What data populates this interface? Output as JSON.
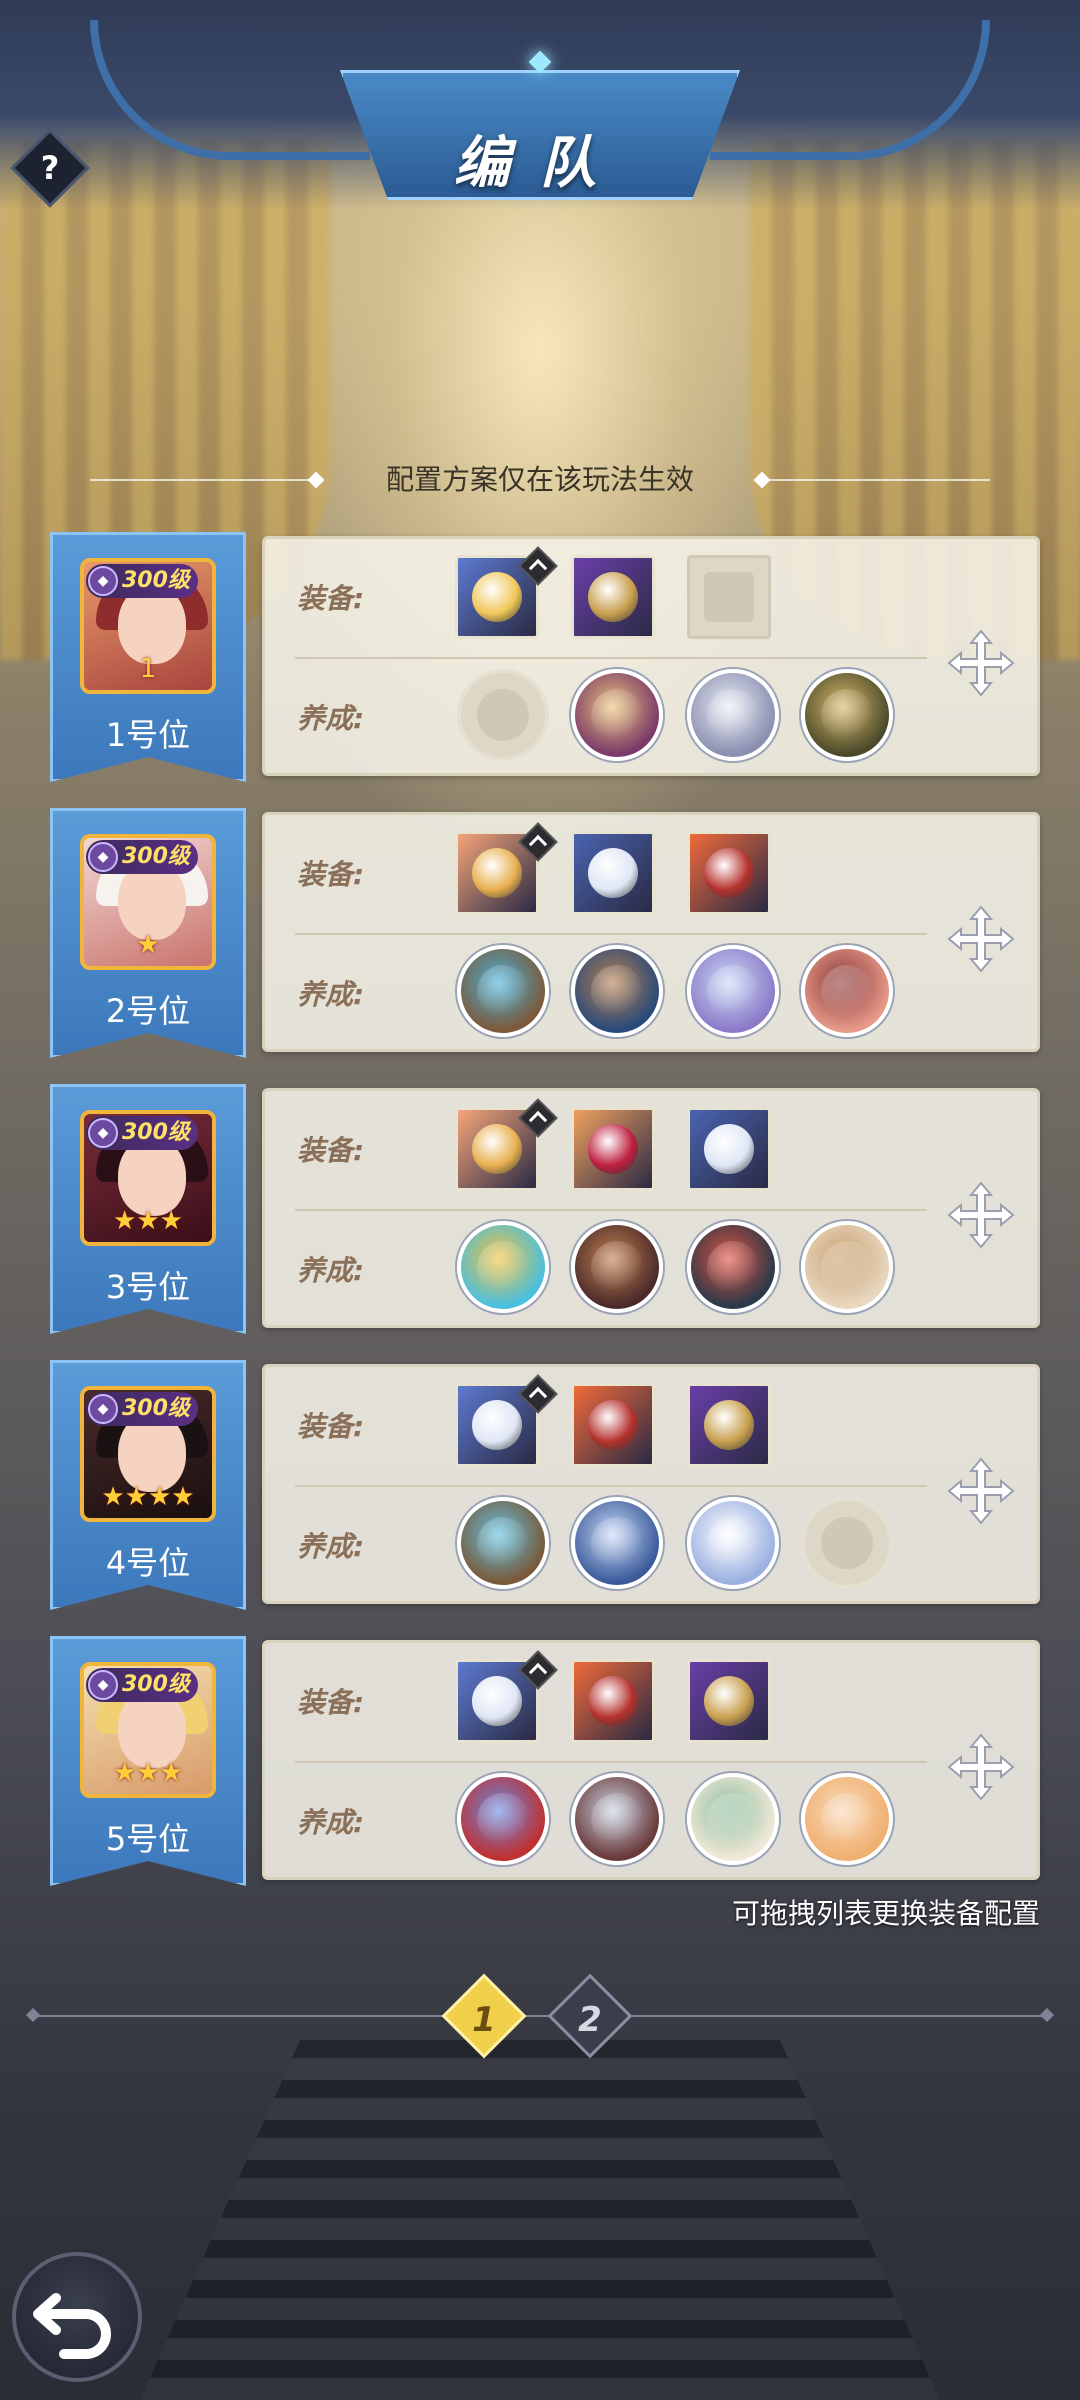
{
  "header": {
    "title": "编队",
    "help_label": "?"
  },
  "subtitle": "配置方案仅在该玩法生效",
  "labels": {
    "equip": "装备:",
    "train": "养成:"
  },
  "slots": [
    {
      "level": "300级",
      "stars": "1",
      "label": "1号位",
      "portrait_colors": [
        "#e79a6a",
        "#a8443e"
      ],
      "hair_color": "#8f2c2c",
      "equip": [
        {
          "name": "ring-icon",
          "bg": "#5d7ad0",
          "color": "#f0c75a",
          "locked": true
        },
        {
          "name": "amulet-icon",
          "bg": "#6a3fa8",
          "color": "#c9a050",
          "locked": false
        },
        {
          "name": "empty-slot-icon",
          "empty": true
        }
      ],
      "train": [
        {
          "name": "empty-slot-icon",
          "empty": true
        },
        {
          "name": "orb-icon",
          "bg": "#7a3a6a",
          "color": "#e8c07a"
        },
        {
          "name": "owl-pet-icon",
          "bg": "#8a8fb0",
          "color": "#e9ecf5"
        },
        {
          "name": "mask-icon",
          "bg": "#4a4a2a",
          "color": "#d8b86a"
        }
      ]
    },
    {
      "level": "300级",
      "stars": "★",
      "label": "2号位",
      "portrait_colors": [
        "#f3d8d5",
        "#c9736c"
      ],
      "hair_color": "#f6f2ee",
      "equip": [
        {
          "name": "ring-icon",
          "bg": "#f5a57a",
          "color": "#e8b050",
          "locked": true
        },
        {
          "name": "cross-icon",
          "bg": "#4a64b0",
          "color": "#dfe6f5",
          "locked": false
        },
        {
          "name": "shield-icon",
          "bg": "#ef6a3a",
          "color": "#b5322e",
          "locked": false
        }
      ],
      "train": [
        {
          "name": "crystal-icon",
          "bg": "#7c5a3a",
          "color": "#4ab0d8"
        },
        {
          "name": "book-icon",
          "bg": "#2a4a7a",
          "color": "#b58050"
        },
        {
          "name": "whale-pet-icon",
          "bg": "#8c7ac8",
          "color": "#c8d8f5"
        },
        {
          "name": "helmet-icon",
          "bg": "#e79a8a",
          "color": "#8a3a3a"
        }
      ]
    },
    {
      "level": "300级",
      "stars": "★★★",
      "label": "3号位",
      "portrait_colors": [
        "#7a2c3a",
        "#3a0f18"
      ],
      "hair_color": "#2a1016",
      "equip": [
        {
          "name": "ring-icon",
          "bg": "#f5a57a",
          "color": "#e8b050",
          "locked": true
        },
        {
          "name": "brooch-icon",
          "bg": "#f0a060",
          "color": "#c02040",
          "locked": false
        },
        {
          "name": "cross-icon",
          "bg": "#4a64b0",
          "color": "#dfe6f5",
          "locked": false
        }
      ],
      "train": [
        {
          "name": "compass-icon",
          "bg": "#4ac0e0",
          "color": "#f0c040"
        },
        {
          "name": "tome-icon",
          "bg": "#4a2a2a",
          "color": "#c08050"
        },
        {
          "name": "arrow-pet-icon",
          "bg": "#2a3a4a",
          "color": "#e05040"
        },
        {
          "name": "priestess-icon",
          "bg": "#e8d8c0",
          "color": "#c8a070"
        }
      ]
    },
    {
      "level": "300级",
      "stars": "★★★★",
      "label": "4号位",
      "portrait_colors": [
        "#4a2a2a",
        "#1a0f0f"
      ],
      "hair_color": "#1a1212",
      "equip": [
        {
          "name": "ring-icon",
          "bg": "#5d7ad0",
          "color": "#dfe6f5",
          "locked": true
        },
        {
          "name": "shield-icon",
          "bg": "#ef6a3a",
          "color": "#b5322e",
          "locked": false
        },
        {
          "name": "amulet-icon",
          "bg": "#6a3fa8",
          "color": "#c9a050",
          "locked": false
        }
      ],
      "train": [
        {
          "name": "rune-icon",
          "bg": "#7a5a3a",
          "color": "#60c0e0"
        },
        {
          "name": "chest-icon",
          "bg": "#3a5a9a",
          "color": "#c8d8f5"
        },
        {
          "name": "cat-pet-icon",
          "bg": "#9ab0e0",
          "color": "#ffffff"
        },
        {
          "name": "empty-slot-icon",
          "empty": true
        }
      ]
    },
    {
      "level": "300级",
      "stars": "★★★",
      "label": "5号位",
      "portrait_colors": [
        "#f4e0b0",
        "#d89a6a"
      ],
      "hair_color": "#f0d070",
      "equip": [
        {
          "name": "ring-icon",
          "bg": "#5d7ad0",
          "color": "#dfe6f5",
          "locked": true
        },
        {
          "name": "shield-icon",
          "bg": "#ef6a3a",
          "color": "#b5322e",
          "locked": false
        },
        {
          "name": "amulet-icon",
          "bg": "#6a3fa8",
          "color": "#c9a050",
          "locked": false
        }
      ],
      "train": [
        {
          "name": "emblem-icon",
          "bg": "#c03030",
          "color": "#6a8ae0"
        },
        {
          "name": "sword-book-icon",
          "bg": "#6a3a3a",
          "color": "#c8d0e0"
        },
        {
          "name": "rabbit-pet-icon",
          "bg": "#f0e8d8",
          "color": "#90c0a0"
        },
        {
          "name": "girl-portrait-icon",
          "bg": "#f0b070",
          "color": "#f8d8b8"
        }
      ]
    }
  ],
  "hint": "可拖拽列表更换装备配置",
  "pagination": {
    "pages": [
      "1",
      "2"
    ],
    "active": "1"
  },
  "colors": {
    "accent": "#f0cf4a",
    "slot_blue": "#4a88c8",
    "card_bg": "#f5f2e8",
    "label_brown": "#8a7058"
  }
}
